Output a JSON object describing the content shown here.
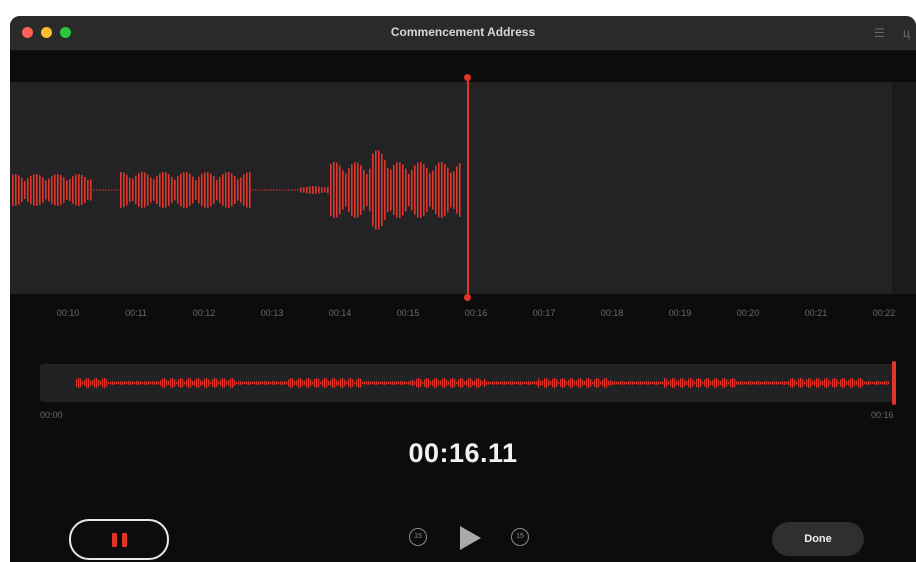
{
  "window": {
    "title": "Commencement Address",
    "toolbar_icons": [
      "settings-sliders-icon",
      "crop-icon"
    ]
  },
  "waveform": {
    "tick_labels": [
      "00:10",
      "00:11",
      "00:12",
      "00:13",
      "00:14",
      "00:15",
      "00:16",
      "00:17",
      "00:18",
      "00:19",
      "00:20",
      "00:21",
      "00:22"
    ],
    "playhead_time": "00:16"
  },
  "overview": {
    "start_label": "00:00",
    "end_label": "00:16"
  },
  "timer": "00:16.11",
  "controls": {
    "pause": "pause-icon",
    "skip_back": "15",
    "play": "play-icon",
    "skip_forward": "15",
    "done_label": "Done"
  },
  "colors": {
    "accent": "#e0352b",
    "background": "#0c0c0d",
    "waveform_bg": "#232325"
  }
}
